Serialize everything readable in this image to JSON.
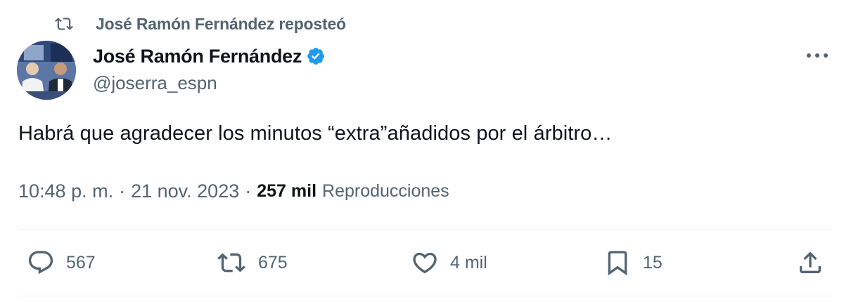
{
  "repost": {
    "icon": "repost-icon",
    "text": "José Ramón Fernández reposteó"
  },
  "author": {
    "display_name": "José Ramón Fernández",
    "handle": "@joserra_espn",
    "verified": true,
    "avatar_icon": "avatar"
  },
  "tweet": {
    "text": "Habrá que agradecer los minutos “extra”añadidos por el árbitro…",
    "time": "10:48 p. m.",
    "date": "21 nov. 2023",
    "views_count": "257 mil",
    "views_label": "Reproducciones",
    "separator": "·"
  },
  "actions": {
    "replies": "567",
    "reposts": "675",
    "likes": "4 mil",
    "bookmarks": "15"
  },
  "colors": {
    "text_primary": "#0f1419",
    "text_secondary": "#536471",
    "verified_blue": "#1d9bf0",
    "divider": "#eff3f4"
  }
}
